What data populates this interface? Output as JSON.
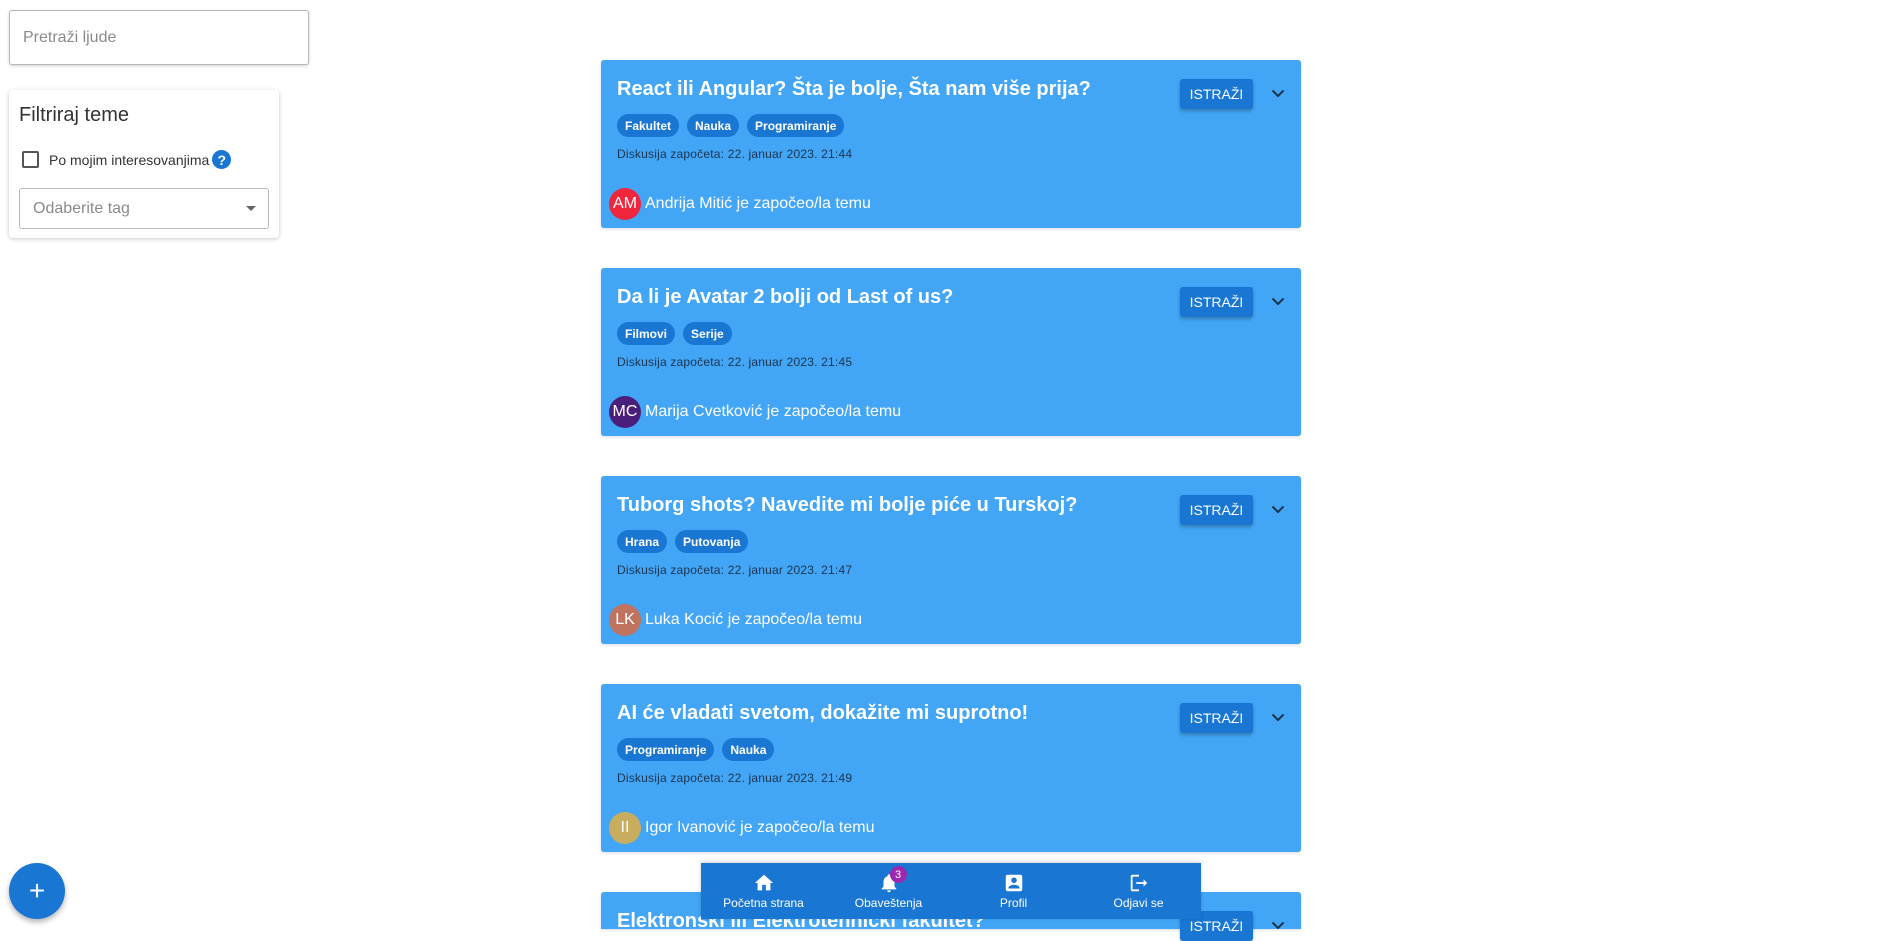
{
  "search": {
    "placeholder": "Pretraži ljude"
  },
  "filter": {
    "title": "Filtriraj teme",
    "checkbox_label": "Po mojim interesovanjima",
    "tag_select_placeholder": "Odaberite tag"
  },
  "topics": [
    {
      "title": "React ili Angular? Šta je bolje, Šta nam više prija?",
      "explore_label": "ISTRAŽI",
      "tags": [
        "Fakultet",
        "Nauka",
        "Programiranje"
      ],
      "started": "Diskusija započeta: 22. januar 2023. 21:44",
      "avatar_initials": "AM",
      "avatar_color": "#f0263c",
      "author_text": "Andrija Mitić je započeo/la temu"
    },
    {
      "title": "Da li je Avatar 2 bolji od Last of us?",
      "explore_label": "ISTRAŽI",
      "tags": [
        "Filmovi",
        "Serije"
      ],
      "started": "Diskusija započeta: 22. januar 2023. 21:45",
      "avatar_initials": "MC",
      "avatar_color": "#4a1f7c",
      "author_text": "Marija Cvetković je započeo/la temu"
    },
    {
      "title": "Tuborg shots? Navedite mi bolje piće u Turskoj?",
      "explore_label": "ISTRAŽI",
      "tags": [
        "Hrana",
        "Putovanja"
      ],
      "started": "Diskusija započeta: 22. januar 2023. 21:47",
      "avatar_initials": "LK",
      "avatar_color": "#c0735f",
      "author_text": "Luka Kocić je započeo/la temu"
    },
    {
      "title": "AI će vladati svetom, dokažite mi suprotno!",
      "explore_label": "ISTRAŽI",
      "tags": [
        "Programiranje",
        "Nauka"
      ],
      "started": "Diskusija započeta: 22. januar 2023. 21:49",
      "avatar_initials": "II",
      "avatar_color": "#c9ad5e",
      "author_text": "Igor Ivanović je započeo/la temu"
    },
    {
      "title": "Elektronski ili Elektrotehnički fakultet?",
      "explore_label": "ISTRAŽI"
    }
  ],
  "nav": {
    "items": [
      {
        "label": "Početna strana",
        "icon": "home-icon"
      },
      {
        "label": "Obaveštenja",
        "icon": "bell-icon",
        "badge": "3"
      },
      {
        "label": "Profil",
        "icon": "profile-icon"
      },
      {
        "label": "Odjavi se",
        "icon": "logout-icon"
      }
    ]
  },
  "fab": {
    "label": "+"
  },
  "colors": {
    "card": "#42a5f5",
    "primary": "#1976d2",
    "badge": "#9c27b0"
  }
}
